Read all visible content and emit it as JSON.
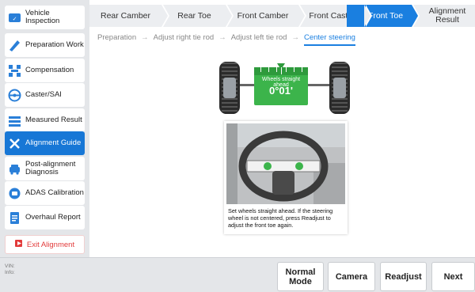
{
  "sidebar": {
    "items": [
      {
        "label": "Vehicle Inspection",
        "icon": "vehicle-inspection-icon"
      },
      {
        "label": "Preparation Work",
        "icon": "preparation-icon"
      },
      {
        "label": "Compensation",
        "icon": "compensation-icon"
      },
      {
        "label": "Caster/SAI",
        "icon": "steering-wheel-icon"
      },
      {
        "label": "Measured Result",
        "icon": "list-icon"
      },
      {
        "label": "Alignment Guide",
        "icon": "wrench-icon",
        "active": true
      },
      {
        "label": "Post-alignment Diagnosis",
        "icon": "car-icon"
      },
      {
        "label": "ADAS Calibration",
        "icon": "adas-icon"
      },
      {
        "label": "Overhaul Report",
        "icon": "report-icon"
      }
    ],
    "exit_label": "Exit Alignment"
  },
  "steps": [
    {
      "label": "Rear Camber"
    },
    {
      "label": "Rear Toe"
    },
    {
      "label": "Front Camber"
    },
    {
      "label": "Front Caster"
    },
    {
      "label": "Front Toe",
      "active": true
    },
    {
      "label": "Alignment Result"
    }
  ],
  "substeps": {
    "items": [
      "Preparation",
      "Adjust right tie rod",
      "Adjust left tie rod",
      "Center steering"
    ],
    "arrow": "→"
  },
  "gauge": {
    "caption": "Wheels straight ahead",
    "value": "0°01'"
  },
  "instruction": {
    "text": "Set wheels straight ahead. If the steering wheel is not centered, press Readjust to adjust the front toe again."
  },
  "footer": {
    "vin_label": "VIN:",
    "info_label": "Info:",
    "buttons": {
      "normal_mode": "Normal Mode",
      "camera": "Camera",
      "readjust": "Readjust",
      "next": "Next"
    }
  },
  "colors": {
    "accent": "#1a7fe0",
    "gauge_green": "#3cb44b",
    "exit_red": "#e23b3b"
  }
}
